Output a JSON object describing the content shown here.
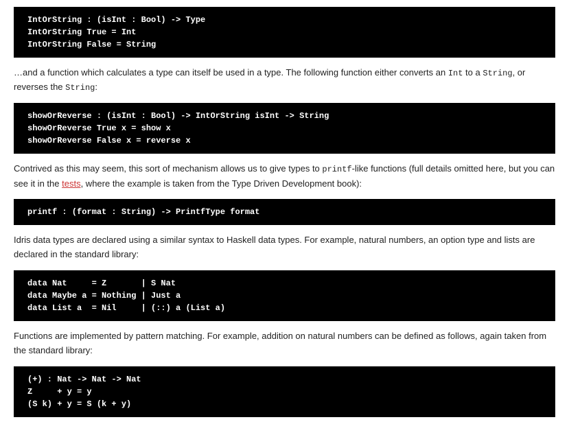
{
  "code1": "IntOrString : (isInt : Bool) -> Type\nIntOrString True = Int\nIntOrString False = String",
  "para1_a": "…and a function which calculates a type can itself be used in a type. The following function either converts an ",
  "para1_code1": "Int",
  "para1_b": " to a ",
  "para1_code2": "String",
  "para1_c": ", or reverses the ",
  "para1_code3": "String",
  "para1_d": ":",
  "code2": "showOrReverse : (isInt : Bool) -> IntOrString isInt -> String\nshowOrReverse True x = show x\nshowOrReverse False x = reverse x",
  "para2_a": "Contrived as this may seem, this sort of mechanism allows us to give types to ",
  "para2_code1": "printf",
  "para2_b": "-like functions (full details omitted here, but you can see it in the ",
  "para2_link": "tests",
  "para2_c": ", where the example is taken from the Type Driven Development book):",
  "code3": "printf : (format : String) -> PrintfType format",
  "para3": "Idris data types are declared using a similar syntax to Haskell data types. For example, natural numbers, an option type and lists are declared in the standard library:",
  "code4": "data Nat     = Z       | S Nat\ndata Maybe a = Nothing | Just a\ndata List a  = Nil     | (::) a (List a)",
  "para4": "Functions are implemented by pattern matching. For example, addition on natural numbers can be defined as follows, again taken from the standard library:",
  "code5": "(+) : Nat -> Nat -> Nat\nZ     + y = y\n(S k) + y = S (k + y)"
}
